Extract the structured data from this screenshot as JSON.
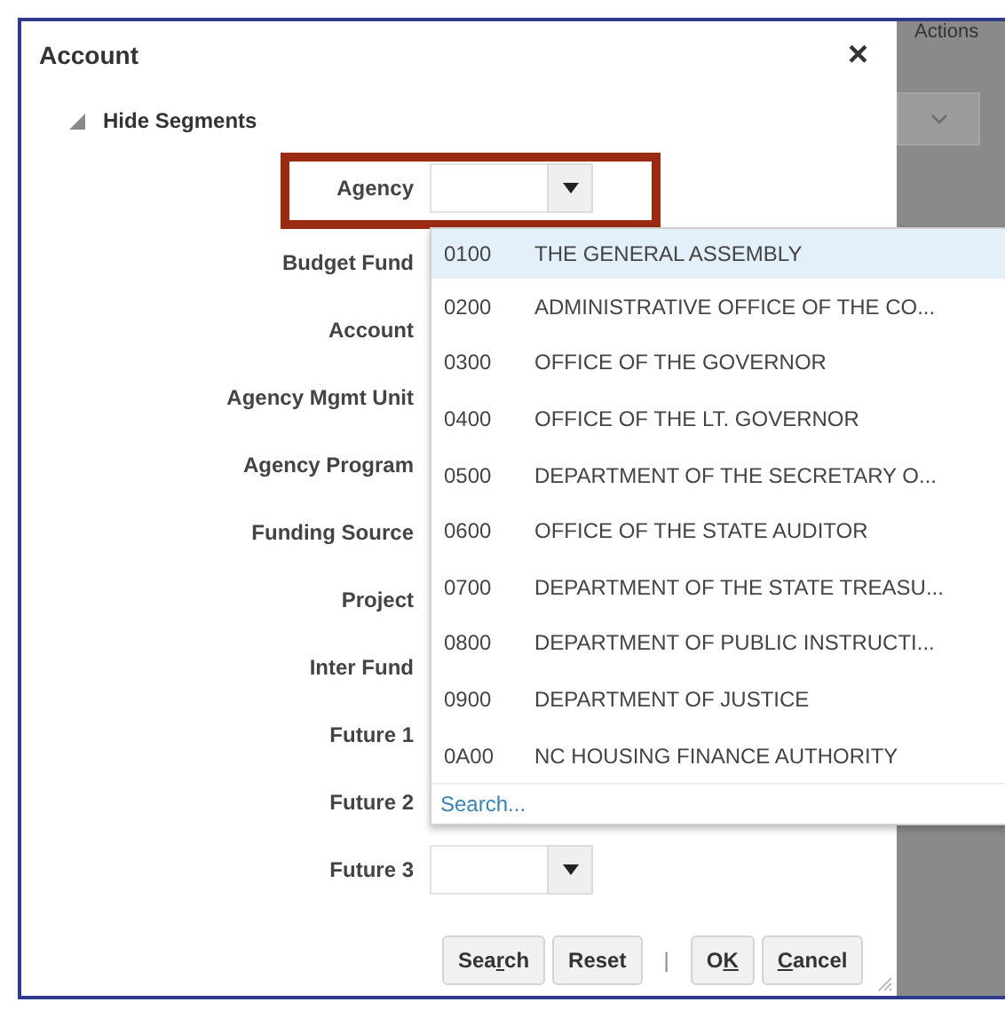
{
  "background": {
    "menu_label": "Actions"
  },
  "dialog": {
    "title": "Account",
    "close": "×",
    "toggle": {
      "label": "Hide Segments",
      "expanded": true
    },
    "fields": [
      {
        "label": "Agency",
        "kind": "combo",
        "highlighted": true
      },
      {
        "label": "Budget Fund",
        "kind": "label",
        "highlighted": false
      },
      {
        "label": "Account",
        "kind": "label",
        "highlighted": false
      },
      {
        "label": "Agency Mgmt Unit",
        "kind": "label",
        "highlighted": false
      },
      {
        "label": "Agency Program",
        "kind": "label",
        "highlighted": false
      },
      {
        "label": "Funding Source",
        "kind": "label",
        "highlighted": false
      },
      {
        "label": "Project",
        "kind": "label",
        "highlighted": false
      },
      {
        "label": "Inter Fund",
        "kind": "label",
        "highlighted": false
      },
      {
        "label": "Future 1",
        "kind": "label",
        "highlighted": false
      },
      {
        "label": "Future 2",
        "kind": "label",
        "highlighted": false
      },
      {
        "label": "Future 3",
        "kind": "combo",
        "highlighted": false
      }
    ],
    "popup": {
      "options": [
        {
          "code": "0100",
          "name": "THE GENERAL ASSEMBLY",
          "selected": true
        },
        {
          "code": "0200",
          "name": "ADMINISTRATIVE OFFICE OF THE CO...",
          "selected": false
        },
        {
          "code": "0300",
          "name": "OFFICE OF THE GOVERNOR",
          "selected": false
        },
        {
          "code": "0400",
          "name": "OFFICE OF THE LT. GOVERNOR",
          "selected": false
        },
        {
          "code": "0500",
          "name": "DEPARTMENT OF THE SECRETARY O...",
          "selected": false
        },
        {
          "code": "0600",
          "name": "OFFICE OF THE STATE AUDITOR",
          "selected": false
        },
        {
          "code": "0700",
          "name": "DEPARTMENT OF THE STATE TREASU...",
          "selected": false
        },
        {
          "code": "0800",
          "name": "DEPARTMENT OF PUBLIC INSTRUCTI...",
          "selected": false
        },
        {
          "code": "0900",
          "name": "DEPARTMENT OF JUSTICE",
          "selected": false
        },
        {
          "code": "0A00",
          "name": "NC HOUSING FINANCE AUTHORITY",
          "selected": false
        }
      ],
      "search_link": "Search..."
    },
    "actions": {
      "left": [
        {
          "before": "Sea",
          "key": "r",
          "after": "ch"
        },
        {
          "before": "Reset"
        }
      ],
      "separator": "|",
      "right": [
        {
          "before": "O",
          "key": "K"
        },
        {
          "key": "C",
          "after": "ancel"
        }
      ]
    }
  }
}
